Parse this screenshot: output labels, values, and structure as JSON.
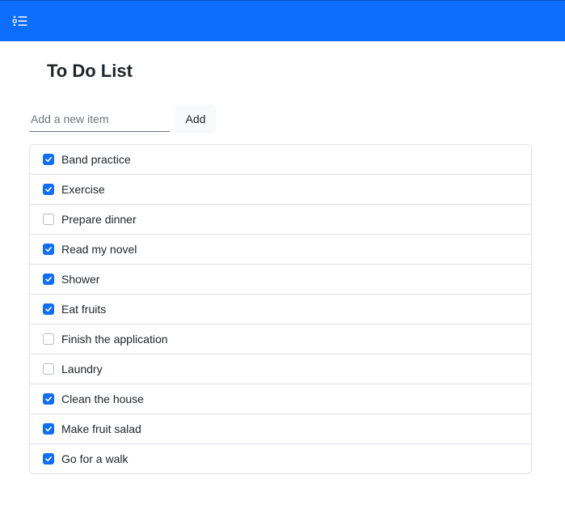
{
  "theme": {
    "navbar_color": "#0d6efd",
    "checkbox_checked_color": "#0d6efd",
    "border_color": "#dee2e6"
  },
  "navbar": {
    "toggle_icon": "list-checks-icon"
  },
  "page": {
    "title": "To Do List"
  },
  "add_form": {
    "input_value": "",
    "input_placeholder": "Add a new item",
    "button_label": "Add"
  },
  "todos": [
    {
      "label": "Band practice",
      "checked": true
    },
    {
      "label": "Exercise",
      "checked": true
    },
    {
      "label": "Prepare dinner",
      "checked": false
    },
    {
      "label": "Read my novel",
      "checked": true
    },
    {
      "label": "Shower",
      "checked": true
    },
    {
      "label": "Eat fruits",
      "checked": true
    },
    {
      "label": "Finish the application",
      "checked": false
    },
    {
      "label": "Laundry",
      "checked": false
    },
    {
      "label": "Clean the house",
      "checked": true
    },
    {
      "label": "Make fruit salad",
      "checked": true
    },
    {
      "label": "Go for a walk",
      "checked": true
    }
  ]
}
